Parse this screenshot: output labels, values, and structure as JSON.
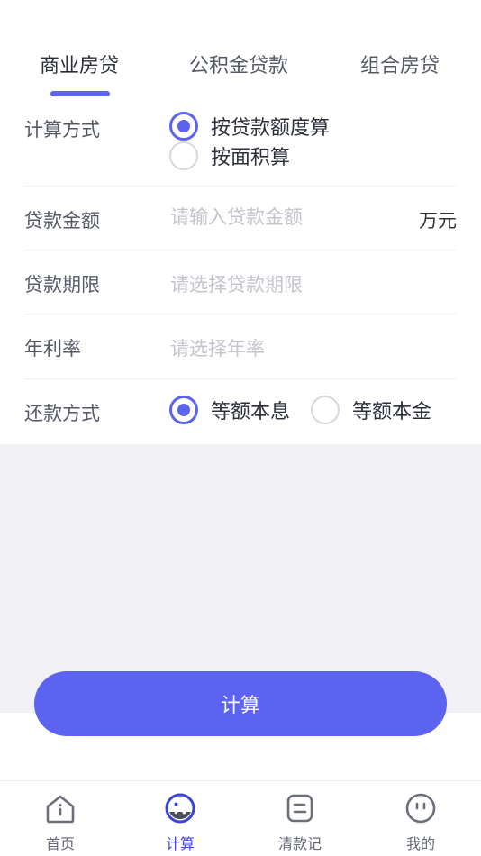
{
  "loan_tabs": [
    {
      "label": "商业房贷",
      "active": true
    },
    {
      "label": "公积金贷款",
      "active": false
    },
    {
      "label": "组合房贷",
      "active": false
    }
  ],
  "calc_method": {
    "label": "计算方式",
    "options": [
      {
        "label": "按贷款额度算",
        "checked": true
      },
      {
        "label": "按面积算",
        "checked": false
      }
    ]
  },
  "loan_amount": {
    "label": "贷款金额",
    "placeholder": "请输入贷款金额",
    "value": "",
    "unit": "万元"
  },
  "loan_term": {
    "label": "贷款期限",
    "placeholder": "请选择贷款期限"
  },
  "annual_rate": {
    "label": "年利率",
    "placeholder": "请选择年率"
  },
  "repay_method": {
    "label": "还款方式",
    "options": [
      {
        "label": "等额本息",
        "checked": true
      },
      {
        "label": "等额本金",
        "checked": false
      }
    ]
  },
  "calculate_button": {
    "label": "计算"
  },
  "tabbar": [
    {
      "label": "首页",
      "icon": "home-icon",
      "active": false
    },
    {
      "label": "计算",
      "icon": "calculator-icon",
      "active": true
    },
    {
      "label": "清款记",
      "icon": "records-icon",
      "active": false
    },
    {
      "label": "我的",
      "icon": "profile-icon",
      "active": false
    }
  ],
  "colors": {
    "accent": "#5b63f0",
    "tabbar_active": "#3c43d8",
    "placeholder": "#c3c5cc",
    "gray_background": "#f1f1f5"
  }
}
